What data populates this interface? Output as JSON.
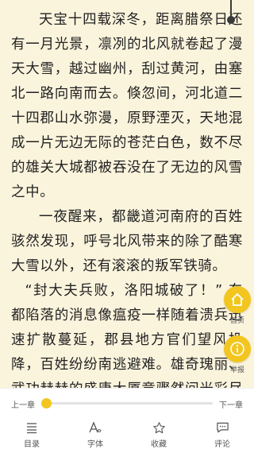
{
  "content": {
    "paragraphs": [
      "天宝十四载深冬，距离腊祭日还有一月光景，凛冽的北风就卷起了漫天大雪，越过幽州，刮过黄河，由塞北一路向南而去。倏忽间，河北道二十四郡山水弥漫，原野湮灭，天地混成一片无边无际的苍茫白色，数不尽的雄关大城都被吞没在了无边的风雪之中。",
      "一夜醒来，都畿道河南府的百姓骇然发现，呼号北风带来的除了酷寒大雪以外，还有滚滚的叛军铁骑。",
      "“封大夫兵败，洛阳城破了！” 东都陷落的消息像瘟疫一样随着溃兵迅速扩散蔓延，郡县地方官们望风投降，百姓纷纷南逃避难。雄奇瑰丽、武功赫赫的盛唐大厦竟骤然间光彩尽失，危如累卵了！"
    ]
  },
  "floating": {
    "home_label": "首页",
    "report_label": "举报"
  },
  "progress": {
    "prev_label": "上一章",
    "next_label": "下一章",
    "value": 0
  },
  "tabs": [
    {
      "label": "目录",
      "icon": "list-icon"
    },
    {
      "label": "字体",
      "icon": "font-icon"
    },
    {
      "label": "收藏",
      "icon": "star-icon"
    },
    {
      "label": "评论",
      "icon": "comment-icon"
    }
  ],
  "colors": {
    "page_bg": "#fbf4dd",
    "accent": "#f2c61f",
    "text": "#222222"
  }
}
